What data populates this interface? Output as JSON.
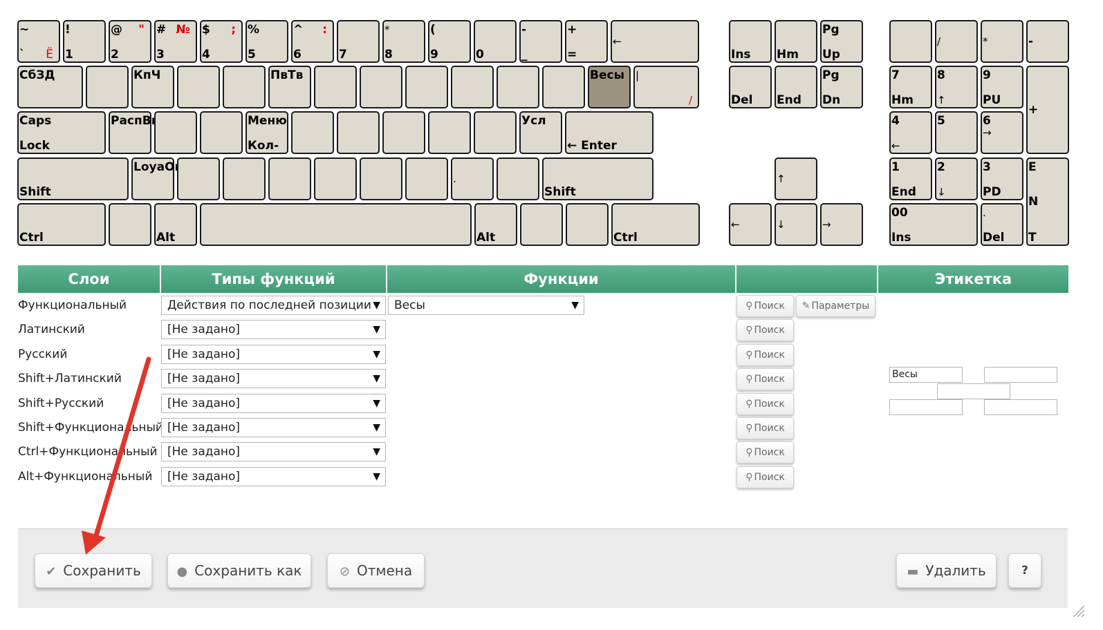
{
  "keyboard": {
    "row1": [
      {
        "tl": "~",
        "bl": "`",
        "br": "Ё"
      },
      {
        "tl": "!",
        "bl": "1"
      },
      {
        "tl": "@",
        "bl": "2",
        "tr": "\""
      },
      {
        "tl": "#",
        "bl": "3",
        "tr": "№"
      },
      {
        "tl": "$",
        "bl": "4",
        "tr": ";"
      },
      {
        "tl": "%",
        "bl": "5"
      },
      {
        "tl": "^",
        "bl": "6",
        "tr": ":"
      },
      {
        "bl": "7"
      },
      {
        "tl": "*",
        "bl": "8"
      },
      {
        "tl": "(",
        "bl": "9"
      },
      {
        "bl": "0"
      },
      {
        "tl": "-",
        "bl": "_"
      },
      {
        "tl": "+",
        "bl": "="
      },
      {
        "ml": "←"
      }
    ],
    "row2": [
      {
        "tl": "СбЗД"
      },
      {},
      {
        "tl": "КпЧ"
      },
      {},
      {},
      {
        "tl": "ПвТв"
      },
      {},
      {},
      {},
      {},
      {},
      {},
      {
        "tl": "Весы"
      },
      {
        "tl": "|",
        "br": "/"
      }
    ],
    "row3": [
      {
        "tl": "Caps",
        "bl": "Lock"
      },
      {
        "tl": "РаспВк"
      },
      {},
      {},
      {
        "tl": "Меню",
        "bl": "Кол-"
      },
      {},
      {},
      {},
      {},
      {},
      {
        "tl": "Усл"
      },
      {
        "bl": "← Enter"
      }
    ],
    "row4": [
      {
        "bl": "Shift"
      },
      {
        "tl": "LoyaOr"
      },
      {},
      {},
      {},
      {},
      {},
      {},
      {
        "ml": "."
      },
      {},
      {
        "bl": "Shift"
      }
    ],
    "row5": [
      {
        "bl": "Ctrl"
      },
      {},
      {
        "bl": "Alt"
      },
      {},
      {
        "bl": "Alt"
      },
      {},
      {},
      {
        "bl": "Ctrl"
      }
    ],
    "nav": [
      {
        "bl": "Ins"
      },
      {
        "bl": "Hm"
      },
      {
        "tl": "Pg",
        "bl": "Up"
      },
      {
        "bl": "Del"
      },
      {
        "bl": "End"
      },
      {
        "tl": "Pg",
        "bl": "Dn"
      },
      {
        "ml": "↑"
      },
      {
        "ml": "←"
      },
      {
        "ml": "↓"
      },
      {
        "ml": "→"
      }
    ],
    "numpad": [
      {},
      {
        "ml": "/"
      },
      {
        "ml": "*"
      },
      {
        "ml": "-"
      },
      {
        "tl": "7",
        "bl": "Hm"
      },
      {
        "tl": "8",
        "bl": "↑"
      },
      {
        "tl": "9",
        "bl": "PU"
      },
      {
        "ml": "+"
      },
      {
        "tl": "4",
        "bl": "←"
      },
      {
        "tl": "5"
      },
      {
        "tl": "6",
        "ml": "→"
      },
      {
        "tl": "1",
        "bl": "End"
      },
      {
        "tl": "2",
        "bl": "↓"
      },
      {
        "tl": "3",
        "bl": "PD"
      },
      {
        "tl": "E",
        "ml": "N",
        "bl": "T"
      },
      {
        "tl": "00",
        "bl": "Ins"
      },
      {
        "tl": ".",
        "bl": "Del"
      }
    ]
  },
  "table": {
    "headers": [
      "Слои",
      "Типы функций",
      "Функции",
      "",
      "Этикетка"
    ],
    "rows": [
      {
        "layer": "Функциональный",
        "type": "Действия по последней позиции"
      },
      {
        "layer": "Латинский",
        "type": "[Не задано]"
      },
      {
        "layer": "Русский",
        "type": "[Не задано]"
      },
      {
        "layer": "Shift+Латинский",
        "type": "[Не задано]"
      },
      {
        "layer": "Shift+Русский",
        "type": "[Не задано]"
      },
      {
        "layer": "Shift+Функциональный",
        "type": "[Не задано]"
      },
      {
        "layer": "Ctrl+Функциональный",
        "type": "[Не задано]"
      },
      {
        "layer": "Alt+Функциональный",
        "type": "[Не задано]"
      }
    ],
    "function_value": "Весы",
    "search_label": "Поиск",
    "params_label": "Параметры",
    "dropdown_arrow": "▼"
  },
  "label_fields": [
    "Весы",
    "",
    "",
    "",
    ""
  ],
  "footer": {
    "save": "Сохранить",
    "save_as": "Сохранить как",
    "cancel": "Отмена",
    "delete": "Удалить",
    "help": "?"
  },
  "colors": {
    "header_green": "#4aa67f",
    "key_bg": "#dedad0",
    "key_active": "#9b9480",
    "annotation_arrow": "#e0352b"
  }
}
